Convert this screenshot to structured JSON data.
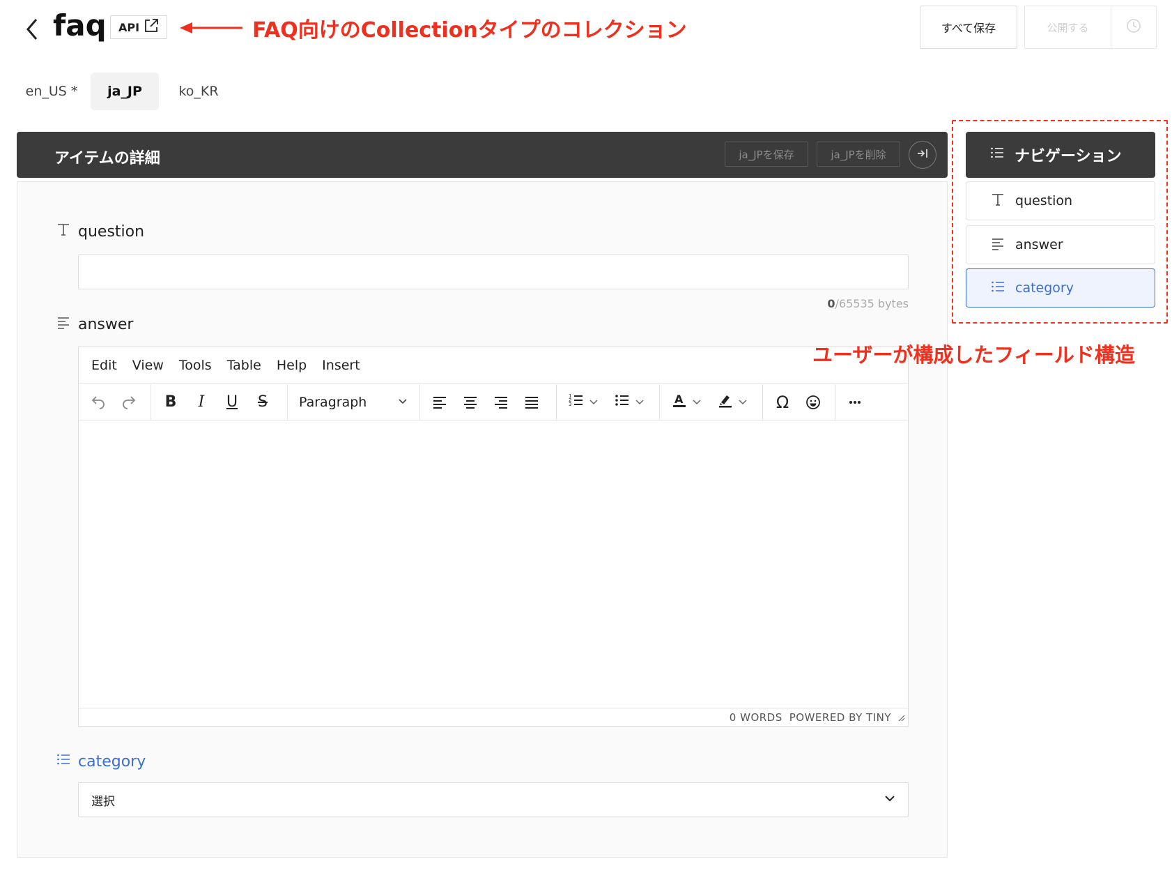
{
  "header": {
    "title": "faq",
    "api_label": "API",
    "annotation": "FAQ向けのCollectionタイプのコレクション",
    "save_all_label": "すべて保存",
    "publish_label": "公開する"
  },
  "locale_tabs": [
    {
      "label": "en_US *"
    },
    {
      "label": "ja_JP"
    },
    {
      "label": "ko_KR"
    }
  ],
  "panel": {
    "title": "アイテムの詳細",
    "save_locale_label": "ja_JPを保存",
    "delete_locale_label": "ja_JPを削除"
  },
  "fields": {
    "question": {
      "label": "question",
      "value": "",
      "byte_used": "0",
      "byte_limit": "/65535 bytes"
    },
    "answer": {
      "label": "answer",
      "menu": [
        "Edit",
        "View",
        "Tools",
        "Table",
        "Help",
        "Insert"
      ],
      "format": "Paragraph",
      "word_count": "0 WORDS",
      "powered_by": "POWERED BY TINY"
    },
    "category": {
      "label": "category",
      "selected": "選択"
    }
  },
  "navigation": {
    "title": "ナビゲーション",
    "items": [
      {
        "label": "question"
      },
      {
        "label": "answer"
      },
      {
        "label": "category"
      }
    ],
    "annotation": "ユーザーが構成したフィールド構造"
  },
  "colors": {
    "accent": "#3a6fd8",
    "annotation": "#f0301e",
    "header_bg": "#3b3b3b"
  }
}
